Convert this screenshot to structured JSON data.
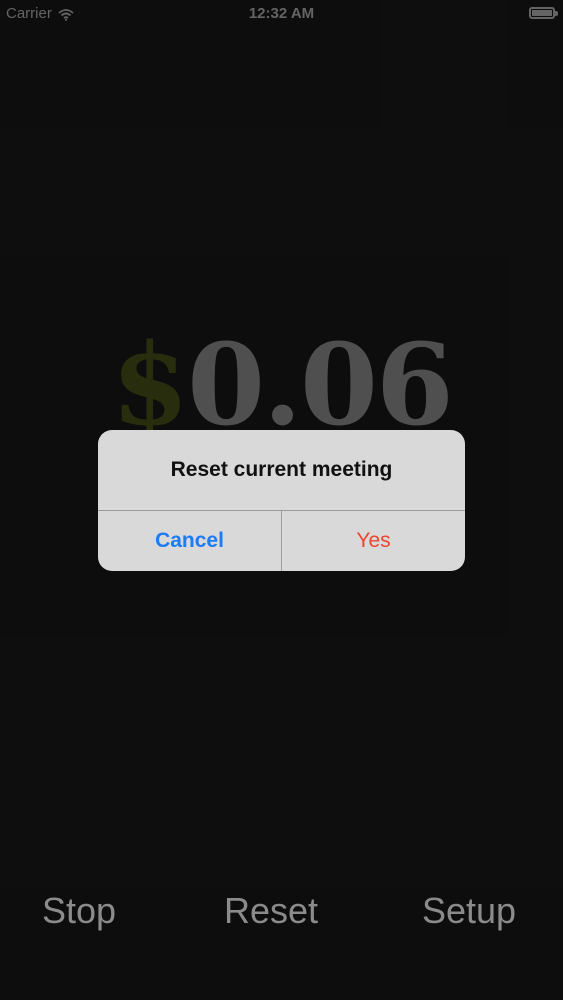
{
  "status_bar": {
    "carrier": "Carrier",
    "time": "12:32 AM",
    "wifi_icon": "wifi-icon",
    "battery_icon": "battery-icon"
  },
  "meter": {
    "currency_symbol": "$",
    "amount": "0.06"
  },
  "alert": {
    "title": "Reset current meeting",
    "cancel_label": "Cancel",
    "yes_label": "Yes"
  },
  "toolbar": {
    "stop_label": "Stop",
    "reset_label": "Reset",
    "setup_label": "Setup"
  },
  "colors": {
    "alert_cancel": "#1e7cf2",
    "alert_yes": "#f0442f",
    "currency": "#3e4814",
    "amount": "#7a7a7a"
  }
}
